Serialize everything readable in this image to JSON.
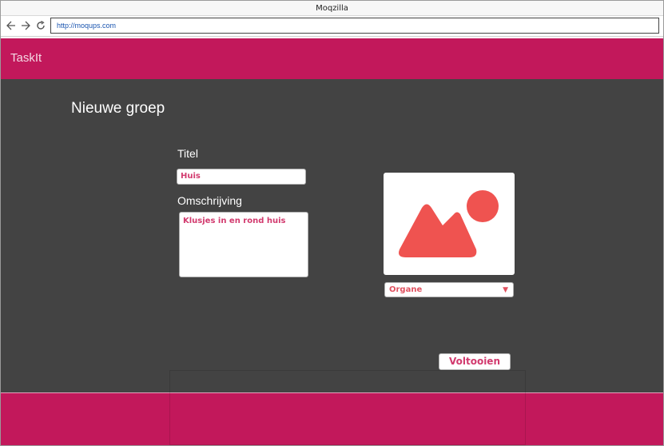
{
  "browser": {
    "window_title": "Moqzilla",
    "url": "http://moqups.com",
    "icons": [
      "back-arrow-icon",
      "forward-arrow-icon",
      "reload-icon"
    ]
  },
  "app": {
    "brand": "TaskIt",
    "header_color": "#c2185b",
    "body_color": "#434343",
    "accent_text_color": "#d23a6e"
  },
  "form": {
    "page_title": "Nieuwe groep",
    "title_label": "Titel",
    "title_value": "Huis",
    "description_label": "Omschrijving",
    "description_value": "Klusjes in en rond huis",
    "image_icon": "image-placeholder-icon",
    "image_icon_color": "#ef5350",
    "color_select_value": "Organe",
    "submit_label": "Voltooien"
  }
}
